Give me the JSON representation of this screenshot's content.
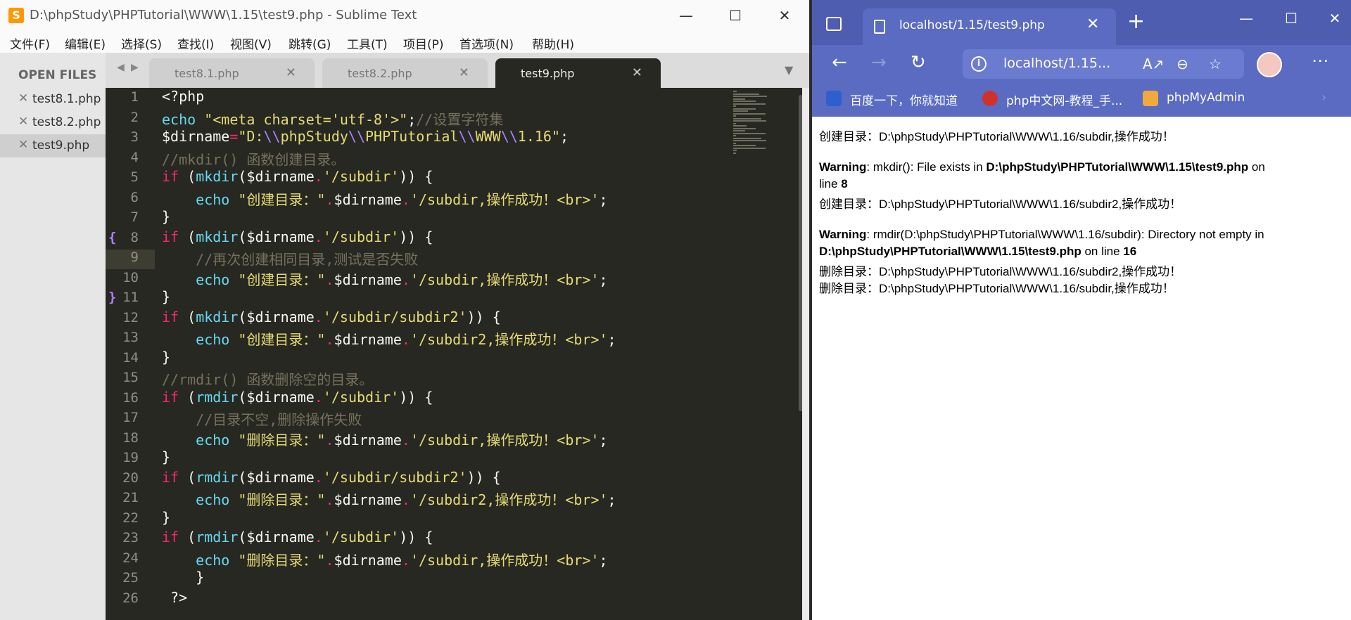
{
  "sublime": {
    "title": "D:\\phpStudy\\PHPTutorial\\WWW\\1.15\\test9.php - Sublime Text",
    "logo": "S",
    "menu": [
      "文件(F)",
      "编辑(E)",
      "选择(S)",
      "查找(I)",
      "视图(V)",
      "跳转(G)",
      "工具(T)",
      "项目(P)",
      "首选项(N)",
      "帮助(H)"
    ],
    "sidebar": {
      "header": "OPEN FILES",
      "files": [
        "test8.1.php",
        "test8.2.php",
        "test9.php"
      ],
      "active_file": "test9.php"
    },
    "tabs": [
      "test8.1.php",
      "test8.2.php",
      "test9.php"
    ],
    "active_tab": "test9.php",
    "line_numbers": [
      "1",
      "2",
      "3",
      "4",
      "5",
      "6",
      "7",
      "8",
      "9",
      "10",
      "11",
      "12",
      "13",
      "14",
      "15",
      "16",
      "17",
      "18",
      "19",
      "20",
      "21",
      "22",
      "23",
      "24",
      "25",
      "26"
    ],
    "fold_markers": [
      "{",
      "}"
    ],
    "code": [
      "<?php",
      "echo \"<meta charset='utf-8'>\";//设置字符集",
      "$dirname=\"D:\\\\phpStudy\\\\PHPTutorial\\\\WWW\\\\1.16\";",
      "//mkdir() 函数创建目录。",
      "if (mkdir($dirname.'/subdir')) {",
      "    echo \"创建目录：\".$dirname.'/subdir,操作成功！<br>';",
      "}",
      "if (mkdir($dirname.'/subdir')) {",
      "    //再次创建相同目录,测试是否失败",
      "    echo \"创建目录：\".$dirname.'/subdir,操作成功！<br>';",
      "}",
      "if (mkdir($dirname.'/subdir/subdir2')) {",
      "    echo \"创建目录：\".$dirname.'/subdir2,操作成功！<br>';",
      "}",
      "//rmdir() 函数删除空的目录。",
      "if (rmdir($dirname.'/subdir')) {",
      "    //目录不空,删除操作失败",
      "    echo \"删除目录：\".$dirname.'/subdir,操作成功！<br>';",
      "}",
      "if (rmdir($dirname.'/subdir/subdir2')) {",
      "    echo \"删除目录：\".$dirname.'/subdir2,操作成功！<br>';",
      "}",
      "if (rmdir($dirname.'/subdir')) {",
      "    echo \"删除目录：\".$dirname.'/subdir,操作成功！<br>';",
      "    }",
      " ?>"
    ]
  },
  "browser": {
    "tab_title": "localhost/1.15/test9.php",
    "url": "localhost/1.15...",
    "favorites": [
      "百度一下，你就知道",
      "php中文网-教程_手...",
      "phpMyAdmin"
    ],
    "output": {
      "line1": "创建目录：D:\\phpStudy\\PHPTutorial\\WWW\\1.16/subdir,操作成功！",
      "warn1_label": "Warning",
      "warn1_text": ": mkdir(): File exists in ",
      "warn1_file": "D:\\phpStudy\\PHPTutorial\\WWW\\1.15\\test9.php",
      "warn1_on": " on",
      "warn1_line_text": "line ",
      "warn1_line": "8",
      "line2": "创建目录：D:\\phpStudy\\PHPTutorial\\WWW\\1.16/subdir2,操作成功！",
      "warn2_label": "Warning",
      "warn2_text": ": rmdir(D:\\phpStudy\\PHPTutorial\\WWW\\1.16/subdir): Directory not empty in",
      "warn2_file": "D:\\phpStudy\\PHPTutorial\\WWW\\1.15\\test9.php",
      "warn2_on": " on line ",
      "warn2_line": "16",
      "line3": "删除目录：D:\\phpStudy\\PHPTutorial\\WWW\\1.16/subdir2,操作成功！",
      "line4": "删除目录：D:\\phpStudy\\PHPTutorial\\WWW\\1.16/subdir,操作成功！"
    }
  },
  "colors": {
    "editor_bg": "#272822",
    "keyword": "#f92672",
    "function": "#66d9ef",
    "string": "#e6db74",
    "comment": "#75715e",
    "browser_accent": "#4f5db0"
  }
}
